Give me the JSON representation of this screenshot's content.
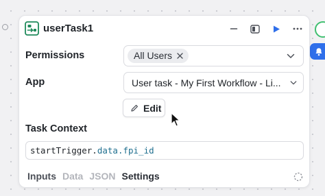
{
  "node": {
    "title": "userTask1",
    "header_icons": [
      "task-icon",
      "minimize-icon",
      "panel-icon",
      "run-icon",
      "more-icon"
    ]
  },
  "permissions": {
    "label": "Permissions",
    "chip": "All Users"
  },
  "app": {
    "label": "App",
    "value": "User task - My First Workflow - Li..."
  },
  "edit_button": {
    "label": "Edit"
  },
  "task_context": {
    "label": "Task Context",
    "code_prefix": "startTrigger.",
    "code_highlight": "data.fpi_id"
  },
  "tabs": [
    {
      "label": "Inputs"
    },
    {
      "label": "Data"
    },
    {
      "label": "JSON"
    },
    {
      "label": "Settings"
    }
  ],
  "colors": {
    "accent": "#2f6fea",
    "success": "#3fbf6f",
    "task_icon": "#1f8a5b"
  }
}
